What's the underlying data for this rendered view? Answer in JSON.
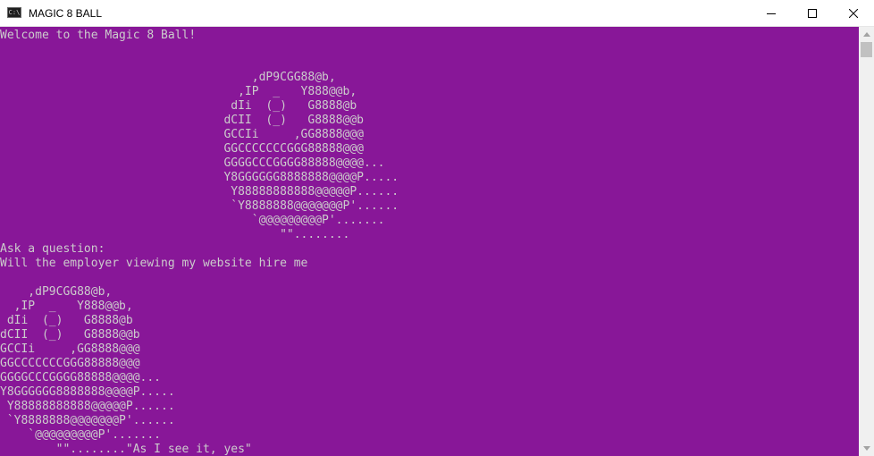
{
  "window": {
    "title": "MAGIC 8 BALL",
    "icon_name": "console-app-icon",
    "icon_text": "C:\\",
    "controls": [
      "minimize-icon",
      "maximize-icon",
      "close-icon"
    ]
  },
  "console": {
    "background_color": "#881798",
    "text_color": "#cccccc",
    "welcome": "Welcome to the Magic 8 Ball!",
    "art_top": "                                    ,dP9CGG88@b,\n                                  ,IP  _   Y888@@b,\n                                 dIi  (_)   G8888@b\n                                dCII  (_)   G8888@@b\n                                GCCIi     ,GG8888@@@\n                                GGCCCCCCCGGG88888@@@\n                                GGGGCCCGGGG88888@@@@...\n                                Y8GGGGGG8888888@@@@P.....\n                                 Y88888888888@@@@@P......\n                                 `Y8888888@@@@@@@P'......\n                                    `@@@@@@@@@P'.......\n                                        \"\"........",
    "prompt": "Ask a question:",
    "question": "Will the employer viewing my website hire me",
    "art_bottom": "    ,dP9CGG88@b,\n  ,IP  _   Y888@@b,\n dIi  (_)   G8888@b\ndCII  (_)   G8888@@b\nGCCIi     ,GG8888@@@\nGGCCCCCCCGGG88888@@@\nGGGGCCCGGGG88888@@@@...\nY8GGGGGG8888888@@@@P.....\n Y88888888888@@@@@P......\n `Y8888888@@@@@@@P'......\n    `@@@@@@@@@P'.......\n        \"\"........\"As I see it, yes\""
  },
  "answer": "As I see it, yes"
}
